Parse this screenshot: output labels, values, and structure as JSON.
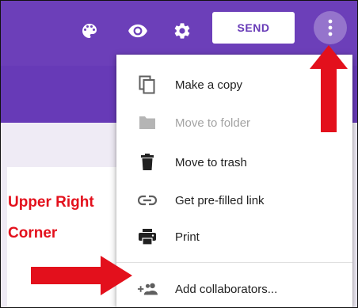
{
  "toolbar": {
    "send_label": "SEND",
    "icons": [
      "palette-icon",
      "eye-icon",
      "gear-icon",
      "more-vert-icon"
    ]
  },
  "menu": {
    "items": [
      {
        "label": "Make a copy",
        "icon": "copy-icon",
        "disabled": false
      },
      {
        "label": "Move to folder",
        "icon": "folder-icon",
        "disabled": true
      },
      {
        "label": "Move to trash",
        "icon": "trash-icon",
        "disabled": false
      },
      {
        "label": "Get pre-filled link",
        "icon": "link-icon",
        "disabled": false
      },
      {
        "label": "Print",
        "icon": "print-icon",
        "disabled": false
      },
      {
        "label": "Add collaborators...",
        "icon": "add-people-icon",
        "disabled": false
      }
    ]
  },
  "annotation": {
    "line1": "Upper Right",
    "line2": "Corner"
  },
  "colors": {
    "brand_purple": "#673ab7",
    "annotation_red": "#e3101c",
    "disabled_text": "#a3a3a3"
  }
}
